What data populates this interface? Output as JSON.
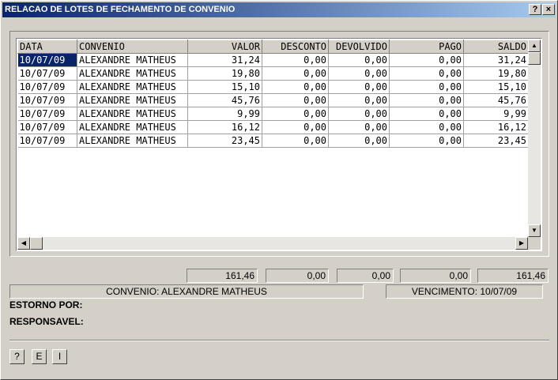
{
  "window": {
    "title": "RELACAO DE LOTES DE FECHAMENTO DE CONVENIO",
    "help_btn": "?",
    "close_btn": "×"
  },
  "grid": {
    "columns": [
      "DATA",
      "CONVENIO",
      "VALOR",
      "DESCONTO",
      "DEVOLVIDO",
      "PAGO",
      "SALDO"
    ],
    "rows": [
      [
        "10/07/09",
        "ALEXANDRE MATHEUS",
        "31,24",
        "0,00",
        "0,00",
        "0,00",
        "31,24"
      ],
      [
        "10/07/09",
        "ALEXANDRE MATHEUS",
        "19,80",
        "0,00",
        "0,00",
        "0,00",
        "19,80"
      ],
      [
        "10/07/09",
        "ALEXANDRE MATHEUS",
        "15,10",
        "0,00",
        "0,00",
        "0,00",
        "15,10"
      ],
      [
        "10/07/09",
        "ALEXANDRE MATHEUS",
        "45,76",
        "0,00",
        "0,00",
        "0,00",
        "45,76"
      ],
      [
        "10/07/09",
        "ALEXANDRE MATHEUS",
        "9,99",
        "0,00",
        "0,00",
        "0,00",
        "9,99"
      ],
      [
        "10/07/09",
        "ALEXANDRE MATHEUS",
        "16,12",
        "0,00",
        "0,00",
        "0,00",
        "16,12"
      ],
      [
        "10/07/09",
        "ALEXANDRE MATHEUS",
        "23,45",
        "0,00",
        "0,00",
        "0,00",
        "23,45"
      ]
    ],
    "selected_row": 0
  },
  "totals": {
    "valor": "161,46",
    "desconto": "0,00",
    "devolvido": "0,00",
    "pago": "0,00",
    "saldo": "161,46"
  },
  "info": {
    "convenio": "CONVENIO: ALEXANDRE MATHEUS",
    "vencimento": "VENCIMENTO: 10/07/09"
  },
  "labels": {
    "estorno": "ESTORNO POR:",
    "responsavel": "RESPONSAVEL:"
  },
  "buttons": {
    "help": "?",
    "e": "E",
    "i": "I"
  },
  "icons": {
    "scroll_up": "triangle-up-icon",
    "scroll_down": "triangle-down-icon",
    "scroll_left": "triangle-left-icon",
    "scroll_right": "triangle-right-icon"
  }
}
